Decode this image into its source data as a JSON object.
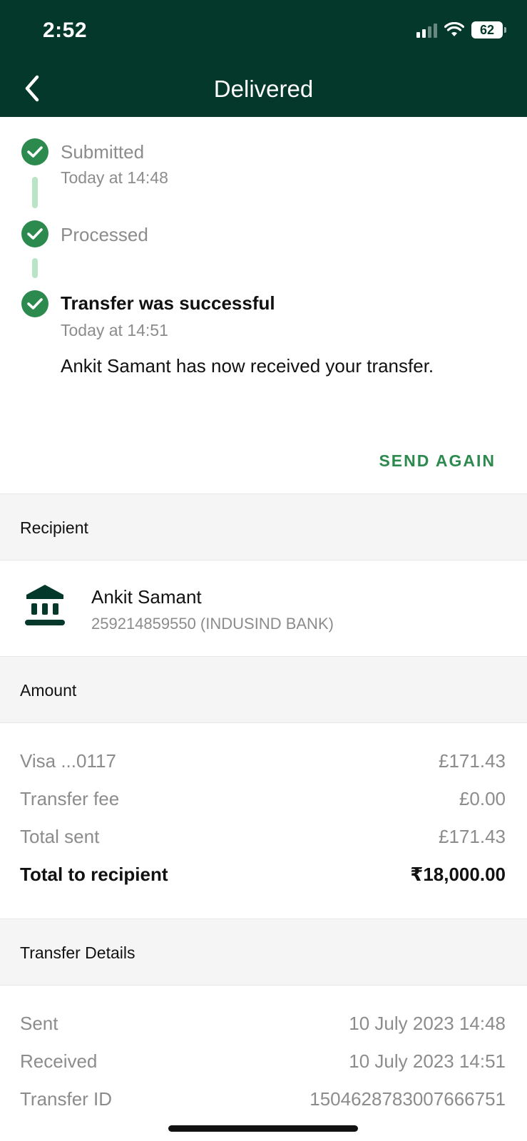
{
  "status_bar": {
    "time": "2:52",
    "battery": "62"
  },
  "header": {
    "title": "Delivered"
  },
  "timeline": {
    "steps": [
      {
        "label": "Submitted",
        "time": "Today at 14:48"
      },
      {
        "label": "Processed",
        "time": ""
      },
      {
        "label": "Transfer was successful",
        "time": "Today at 14:51",
        "description": "Ankit Samant has now received your transfer."
      }
    ],
    "send_again_label": "SEND AGAIN"
  },
  "recipient": {
    "section_title": "Recipient",
    "name": "Ankit Samant",
    "account": "259214859550 (INDUSIND BANK)"
  },
  "amount": {
    "section_title": "Amount",
    "rows": [
      {
        "label": "Visa ...0117",
        "value": "£171.43"
      },
      {
        "label": "Transfer fee",
        "value": "£0.00"
      },
      {
        "label": "Total sent",
        "value": "£171.43"
      },
      {
        "label": "Total to recipient",
        "value": "₹18,000.00"
      }
    ]
  },
  "transfer_details": {
    "section_title": "Transfer Details",
    "rows": [
      {
        "label": "Sent",
        "value": "10 July 2023 14:48"
      },
      {
        "label": "Received",
        "value": "10 July 2023 14:51"
      },
      {
        "label": "Transfer ID",
        "value": "1504628783007666751"
      }
    ]
  },
  "colors": {
    "header_bg": "#03382a",
    "accent_green": "#2d8a4e",
    "connector_green": "#b9e4c6"
  }
}
